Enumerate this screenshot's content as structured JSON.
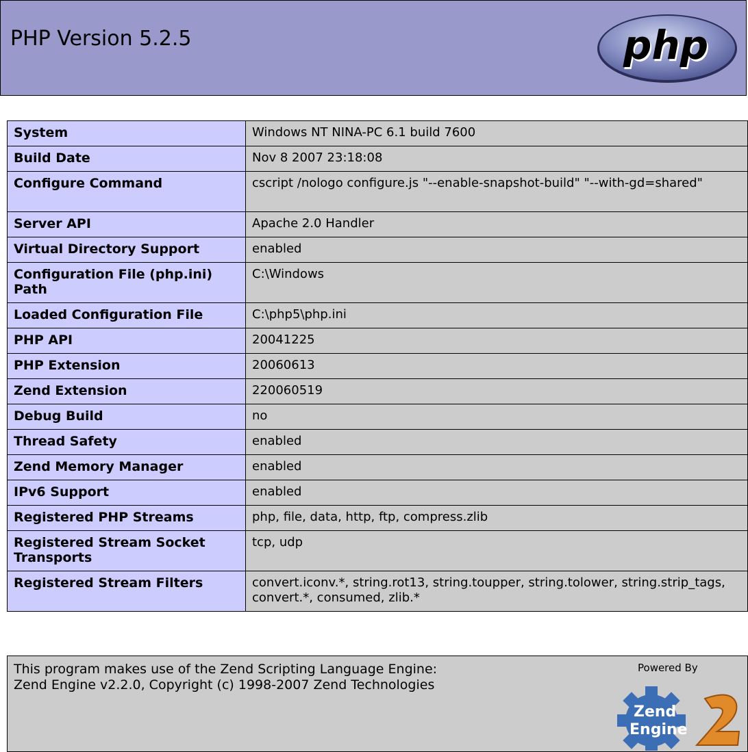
{
  "header": {
    "title": "PHP Version 5.2.5",
    "logo_text": "php"
  },
  "info_rows": [
    {
      "label": "System",
      "value": "Windows NT NINA-PC 6.1 build 7600"
    },
    {
      "label": "Build Date",
      "value": "Nov 8 2007 23:18:08"
    },
    {
      "label": "Configure Command",
      "value": "cscript /nologo configure.js \"--enable-snapshot-build\" \"--with-gd=shared\""
    },
    {
      "label": "Server API",
      "value": "Apache 2.0 Handler"
    },
    {
      "label": "Virtual Directory Support",
      "value": "enabled"
    },
    {
      "label": "Configuration File (php.ini) Path",
      "value": "C:\\Windows"
    },
    {
      "label": "Loaded Configuration File",
      "value": "C:\\php5\\php.ini"
    },
    {
      "label": "PHP API",
      "value": "20041225"
    },
    {
      "label": "PHP Extension",
      "value": "20060613"
    },
    {
      "label": "Zend Extension",
      "value": "220060519"
    },
    {
      "label": "Debug Build",
      "value": "no"
    },
    {
      "label": "Thread Safety",
      "value": "enabled"
    },
    {
      "label": "Zend Memory Manager",
      "value": "enabled"
    },
    {
      "label": "IPv6 Support",
      "value": "enabled"
    },
    {
      "label": "Registered PHP Streams",
      "value": "php, file, data, http, ftp, compress.zlib"
    },
    {
      "label": "Registered Stream Socket Transports",
      "value": "tcp, udp"
    },
    {
      "label": "Registered Stream Filters",
      "value": "convert.iconv.*, string.rot13, string.toupper, string.tolower, string.strip_tags, convert.*, consumed, zlib.*"
    }
  ],
  "footer": {
    "line1": "This program makes use of the Zend Scripting Language Engine:",
    "line2": "Zend Engine v2.2.0, Copyright (c) 1998-2007 Zend Technologies",
    "powered_by": "Powered By",
    "logo_text_1": "Zend",
    "logo_text_2": "Engine",
    "logo_text_3": "2"
  },
  "colors": {
    "header_bg": "#9999cc",
    "label_bg": "#ccccff",
    "value_bg": "#cccccc"
  }
}
